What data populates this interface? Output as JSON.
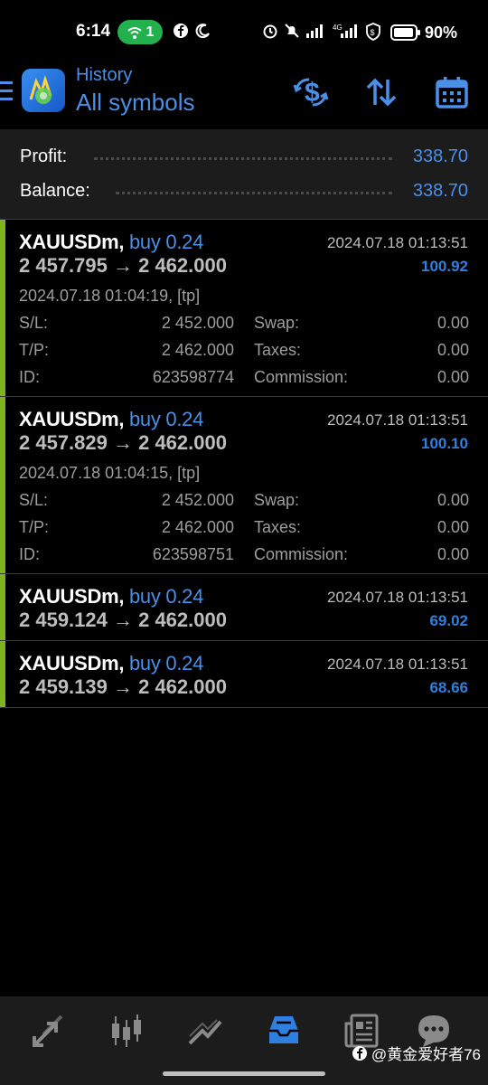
{
  "status_bar": {
    "time": "6:14",
    "hotspot_count": "1",
    "battery": "90%"
  },
  "header": {
    "subtitle": "History",
    "title": "All symbols"
  },
  "summary": {
    "profit_label": "Profit:",
    "profit_value": "338.70",
    "balance_label": "Balance:",
    "balance_value": "338.70"
  },
  "deals": [
    {
      "symbol": "XAUUSDm,",
      "side": "buy 0.24",
      "close_time": "2024.07.18 01:13:51",
      "prices": "2 457.795 → 2 462.000",
      "profit": "100.92",
      "open_time": "2024.07.18 01:04:19, [tp]",
      "sl_label": "S/L:",
      "sl": "2 452.000",
      "tp_label": "T/P:",
      "tp": "2 462.000",
      "id_label": "ID:",
      "id": "623598774",
      "swap_label": "Swap:",
      "swap": "0.00",
      "taxes_label": "Taxes:",
      "taxes": "0.00",
      "commission_label": "Commission:",
      "commission": "0.00"
    },
    {
      "symbol": "XAUUSDm,",
      "side": "buy 0.24",
      "close_time": "2024.07.18 01:13:51",
      "prices": "2 457.829 → 2 462.000",
      "profit": "100.10",
      "open_time": "2024.07.18 01:04:15, [tp]",
      "sl_label": "S/L:",
      "sl": "2 452.000",
      "tp_label": "T/P:",
      "tp": "2 462.000",
      "id_label": "ID:",
      "id": "623598751",
      "swap_label": "Swap:",
      "swap": "0.00",
      "taxes_label": "Taxes:",
      "taxes": "0.00",
      "commission_label": "Commission:",
      "commission": "0.00"
    },
    {
      "symbol": "XAUUSDm,",
      "side": "buy 0.24",
      "close_time": "2024.07.18 01:13:51",
      "prices": "2 459.124 → 2 462.000",
      "profit": "69.02"
    },
    {
      "symbol": "XAUUSDm,",
      "side": "buy 0.24",
      "close_time": "2024.07.18 01:13:51",
      "prices": "2 459.139 → 2 462.000",
      "profit": "68.66"
    }
  ],
  "watermark": "@黄金爱好者76",
  "colors": {
    "accent": "#4a8fe8",
    "profit": "#2f7fe0",
    "buy_bar": "#7fb41e",
    "hotspot": "#23b14d"
  },
  "icons": {
    "header": [
      "menu-icon",
      "app-logo",
      "deposit-withdraw-icon",
      "sort-icon",
      "calendar-icon"
    ],
    "nav": [
      "trade-icon",
      "chart-icon",
      "quotes-icon",
      "history-icon",
      "news-icon",
      "chat-icon"
    ]
  }
}
